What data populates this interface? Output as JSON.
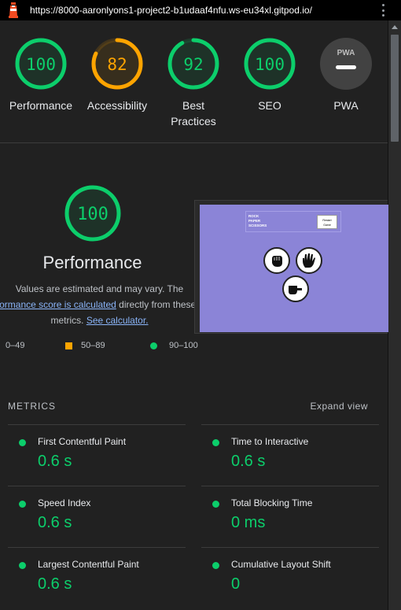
{
  "browser": {
    "url": "https://8000-aaronlyons1-project2-b1udaaf4nfu.ws-eu34xl.gitpod.io/"
  },
  "gauges": [
    {
      "label": "Performance",
      "score": "100",
      "value": 100,
      "color": "#0cce6b"
    },
    {
      "label": "Accessibility",
      "score": "82",
      "value": 82,
      "color": "#ffa400"
    },
    {
      "label_line1": "Best",
      "label_line2": "Practices",
      "score": "92",
      "value": 92,
      "color": "#0cce6b"
    },
    {
      "label": "SEO",
      "score": "100",
      "value": 100,
      "color": "#0cce6b"
    },
    {
      "label": "PWA",
      "badge": "PWA"
    }
  ],
  "performance": {
    "score": "100",
    "value": 100,
    "title": "Performance",
    "disclaimer_line1": "Values are estimated and may vary. The",
    "disclaimer_link1": "formance score is calculated",
    "disclaimer_line2_rest": " directly from these",
    "disclaimer_line3": "metrics. ",
    "disclaimer_link2": "See calculator.",
    "legend": {
      "fail": "0–49",
      "average": "50–89",
      "pass": "90–100"
    }
  },
  "preview": {
    "logo_line1": "ROCK",
    "logo_line2": "PAPER",
    "logo_line3": "SCISSORS",
    "restart_line1": "Restart",
    "restart_line2": "Game"
  },
  "metrics": {
    "header": "METRICS",
    "expand": "Expand view",
    "items": [
      {
        "name": "First Contentful Paint",
        "value": "0.6 s"
      },
      {
        "name": "Time to Interactive",
        "value": "0.6 s"
      },
      {
        "name": "Speed Index",
        "value": "0.6 s"
      },
      {
        "name": "Total Blocking Time",
        "value": "0 ms"
      },
      {
        "name": "Largest Contentful Paint",
        "value": "0.6 s"
      },
      {
        "name": "Cumulative Layout Shift",
        "value": "0"
      }
    ]
  },
  "colors": {
    "pass": "#0cce6b",
    "average": "#ffa400",
    "link": "#8ab4f8",
    "background": "#212121"
  }
}
